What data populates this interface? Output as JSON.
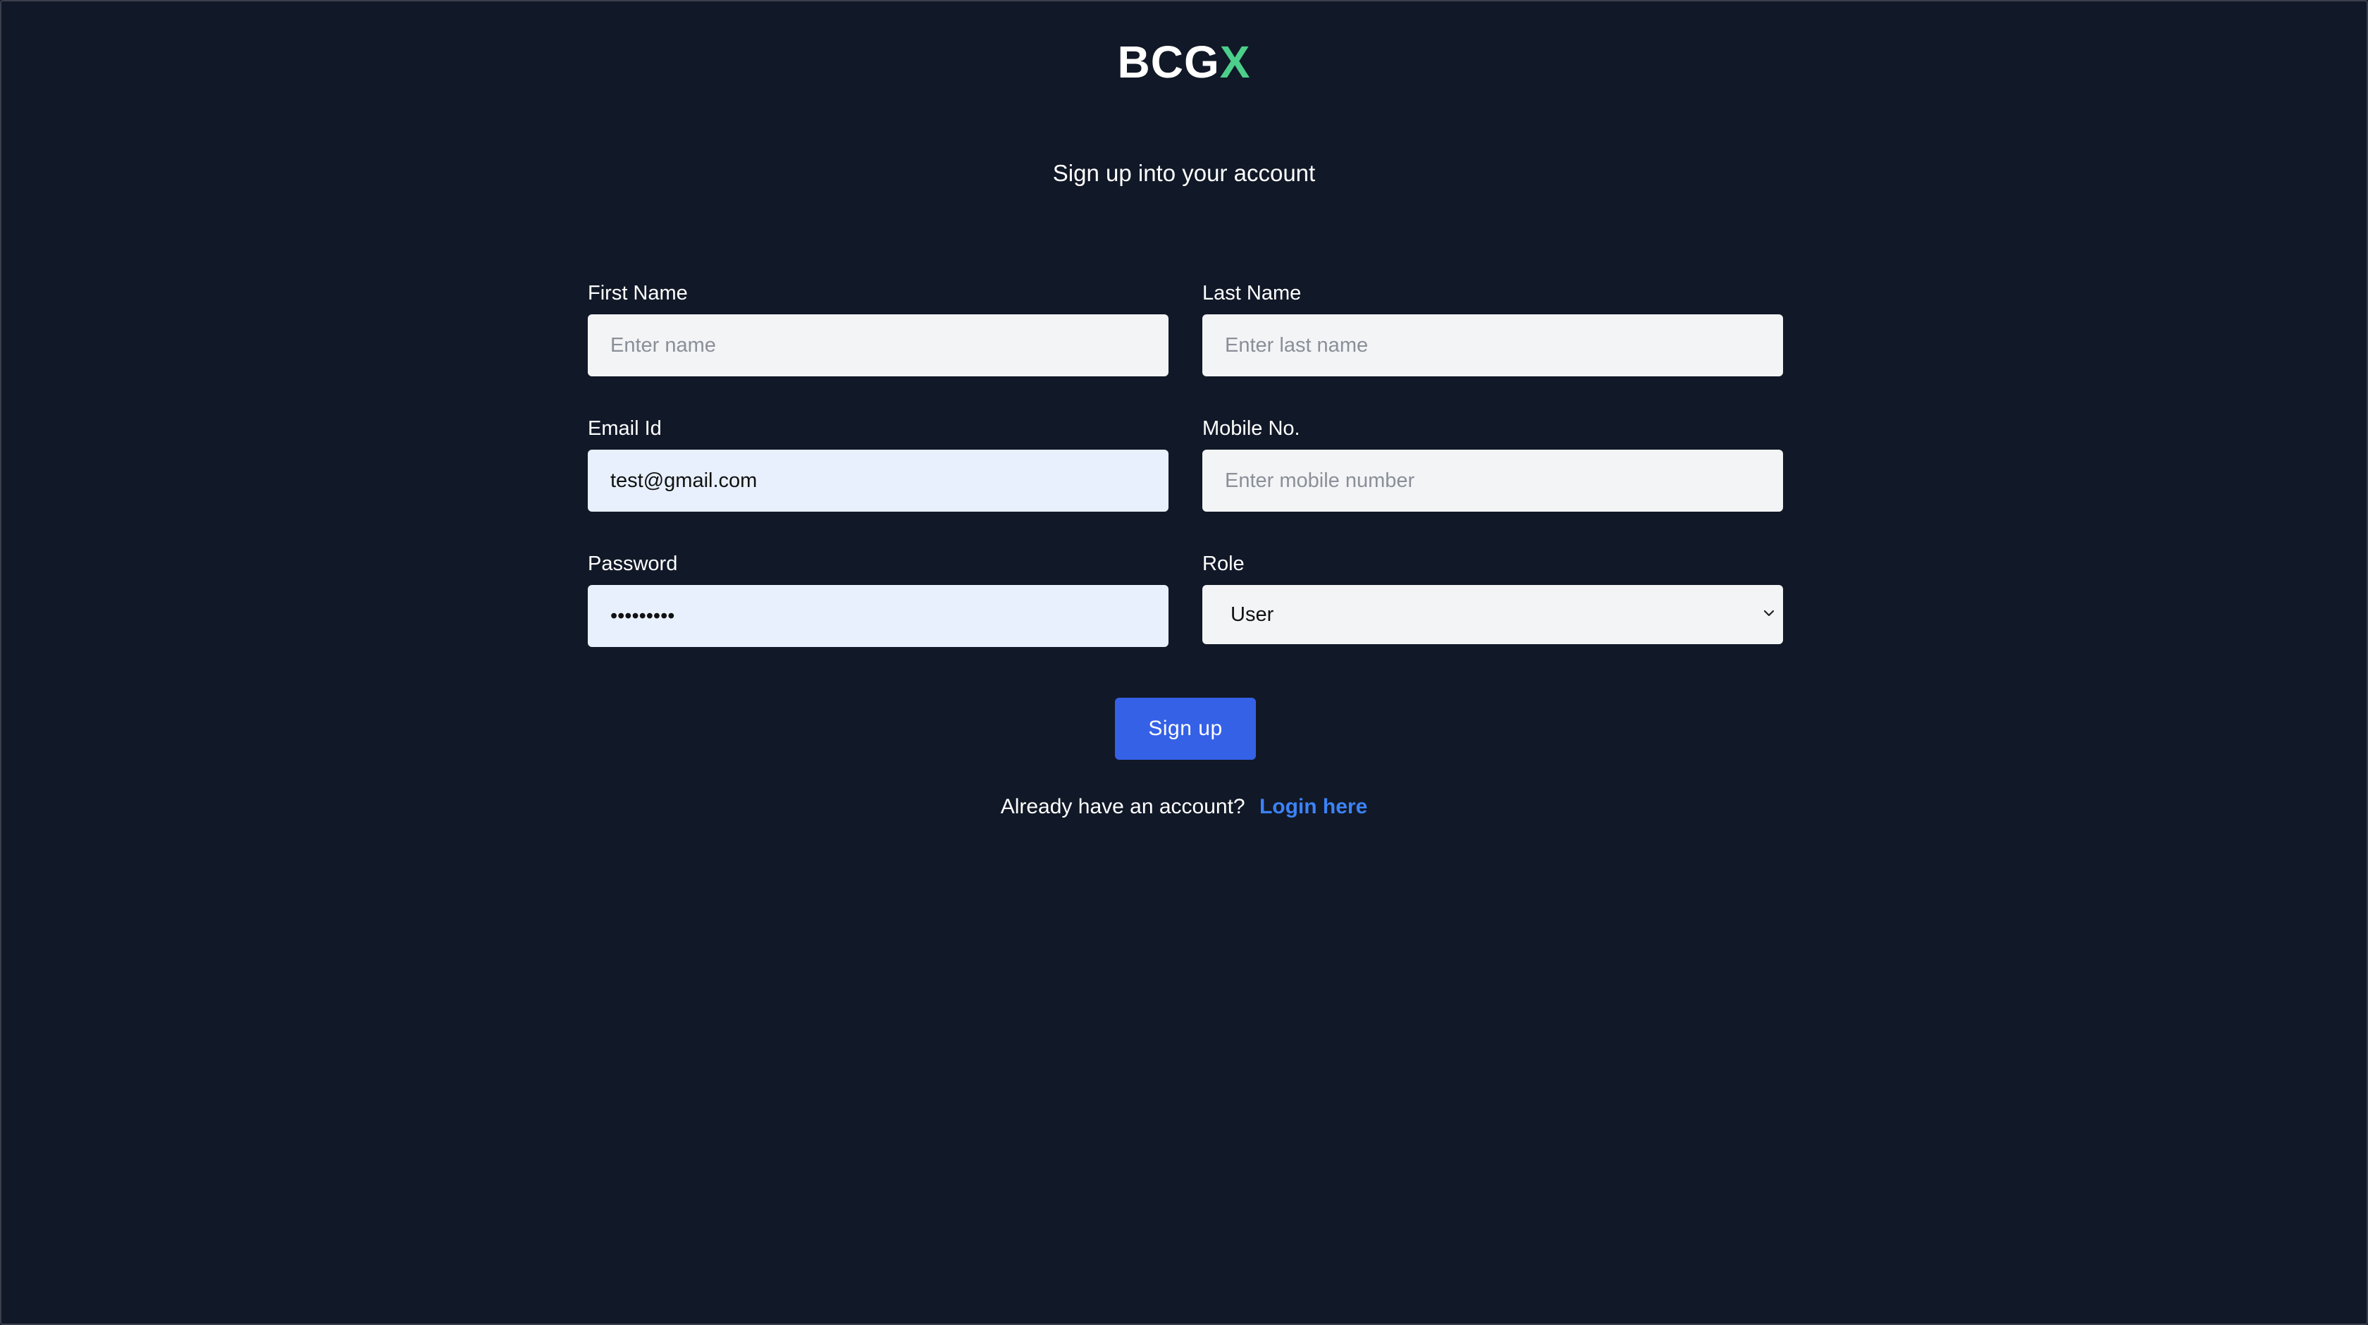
{
  "brand": {
    "logo_main": "BCG",
    "logo_accent": "X",
    "accent_color": "#4ccf8a"
  },
  "heading": {
    "subtitle": "Sign up into your account"
  },
  "form": {
    "first_name": {
      "label": "First Name",
      "placeholder": "Enter name",
      "value": ""
    },
    "last_name": {
      "label": "Last Name",
      "placeholder": "Enter last name",
      "value": ""
    },
    "email": {
      "label": "Email Id",
      "placeholder": "",
      "value": "test@gmail.com"
    },
    "mobile": {
      "label": "Mobile No.",
      "placeholder": "Enter mobile number",
      "value": ""
    },
    "password": {
      "label": "Password",
      "value": "•••••••••"
    },
    "role": {
      "label": "Role",
      "selected": "User"
    }
  },
  "actions": {
    "signup_label": "Sign up",
    "signup_color": "#3561e6"
  },
  "footer": {
    "prompt": "Already have an account?",
    "login_link": "Login here",
    "link_color": "#3b82f6"
  },
  "icons": {
    "role_dropdown": "chevron-down-icon"
  }
}
